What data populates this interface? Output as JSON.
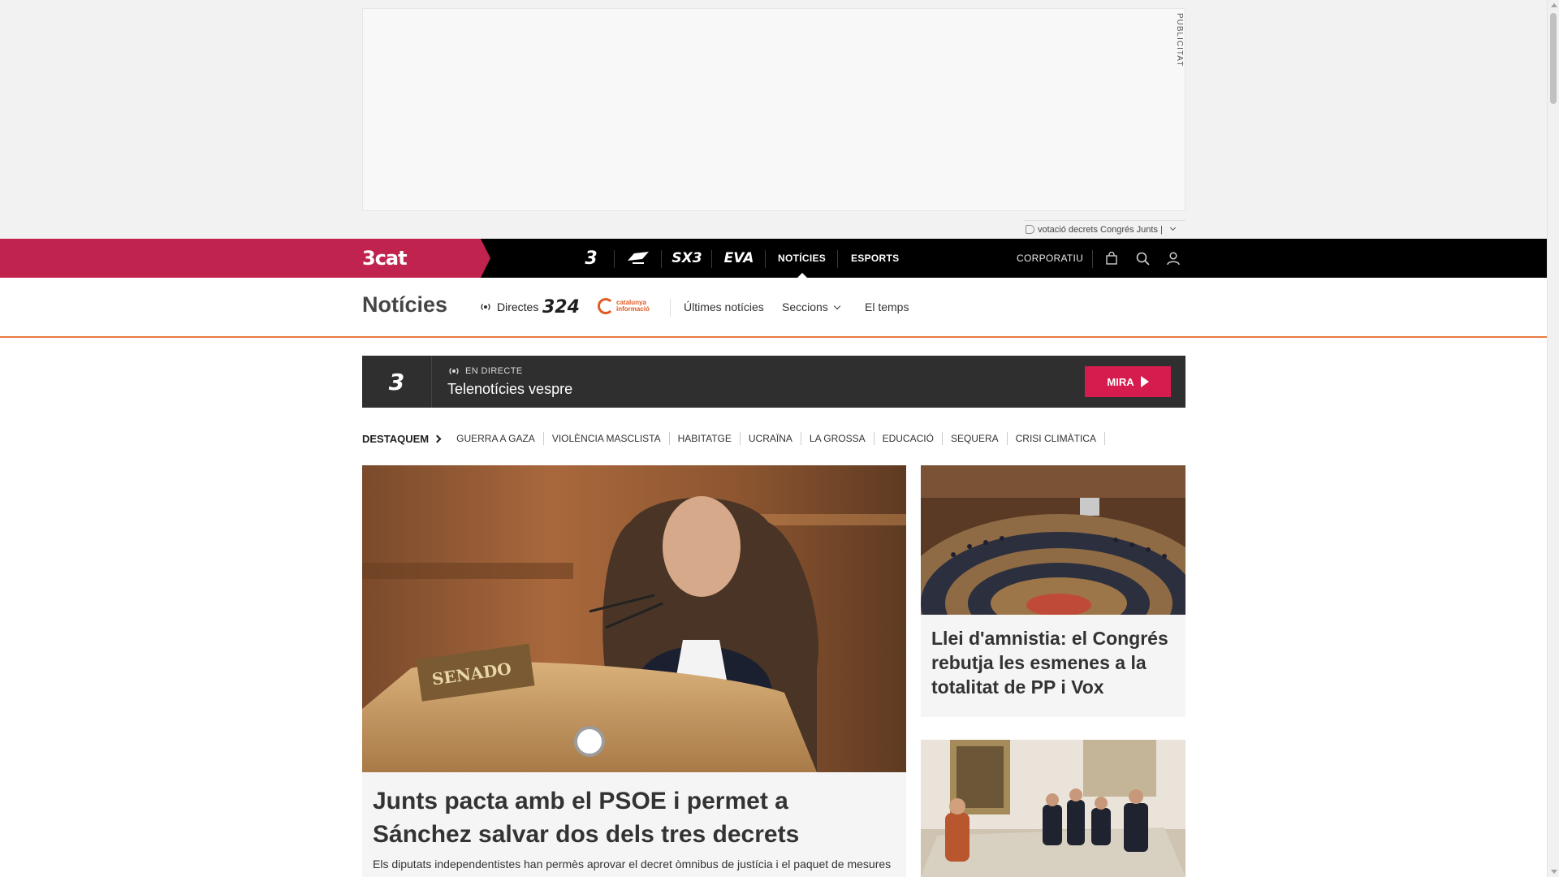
{
  "ad": {
    "label": "PUBLICITAT",
    "tag_text": "votació decrets Congrés Junts |"
  },
  "topnav": {
    "brand": "3cat",
    "channels": [
      "3",
      "Cat Ràdio",
      "SX3",
      "EVA"
    ],
    "links": [
      {
        "label": "NOTÍCIES",
        "active": true
      },
      {
        "label": "ESPORTS",
        "active": false
      }
    ],
    "corporate": "CORPORATIU",
    "icons": [
      "shopping-bag-icon",
      "search-icon",
      "user-icon"
    ]
  },
  "section": {
    "title": "Notícies",
    "directes": "Directes",
    "logo_324": "324",
    "logo_ci_line1": "catalunya",
    "logo_ci_line2": "informació",
    "links": [
      "Últimes notícies",
      "Seccions",
      "El temps"
    ]
  },
  "live": {
    "channel": "3",
    "label": "EN DIRECTE",
    "title": "Telenotícies vespre",
    "button": "MIRA"
  },
  "destaquem": {
    "heading": "DESTAQUEM",
    "items": [
      "GUERRA A GAZA",
      "VIOLÈNCIA MASCLISTA",
      "HABITATGE",
      "UCRAÏNA",
      "LA GROSSA",
      "EDUCACIÓ",
      "SEQUERA",
      "CRISI CLIMÀTICA"
    ]
  },
  "stories": {
    "main": {
      "title": "Junts pacta amb el PSOE i permet a Sánchez salvar dos dels tres decrets",
      "subtitle": "Els diputats independentistes han permès aprovar el decret òmnibus de justícia i el paquet de mesures",
      "photo_sign": "SENADO"
    },
    "side1": {
      "title": "Llei d'amnistia: el Congrés rebutja les esmenes a la totalitat de PP i Vox"
    }
  },
  "colors": {
    "brand": "#c0244e",
    "accent_orange": "#e87a3f",
    "live_red": "#d61c4e",
    "nav_bg": "#000000"
  }
}
